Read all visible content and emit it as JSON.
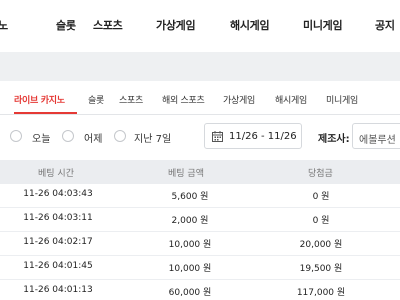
{
  "top_nav": {
    "items": [
      "노",
      "슬롯",
      "스포츠",
      "가상게임",
      "해시게임",
      "미니게임",
      "공지"
    ]
  },
  "sub_tabs": {
    "items": [
      "라이브 카지노",
      "슬롯",
      "스포츠",
      "해외 스포츠",
      "가상게임",
      "해시게임",
      "미니게임"
    ],
    "active_index": 0
  },
  "filters": {
    "radios": [
      "오늘",
      "어제",
      "지난 7일"
    ],
    "date_range": "11/26 - 11/26",
    "provider_label": "제조사:",
    "provider_value": "에볼루션"
  },
  "table": {
    "headers": [
      "베팅 시간",
      "베팅 금액",
      "당첨금"
    ],
    "rows": [
      {
        "time": "11-26 04:03:43",
        "amount": "5,600 원",
        "win": "0 원"
      },
      {
        "time": "11-26 04:03:11",
        "amount": "2,000 원",
        "win": "0 원"
      },
      {
        "time": "11-26 04:02:17",
        "amount": "10,000 원",
        "win": "20,000 원"
      },
      {
        "time": "11-26 04:01:45",
        "amount": "10,000 원",
        "win": "19,500 원"
      },
      {
        "time": "11-26 04:01:13",
        "amount": "60,000 원",
        "win": "117,000 원"
      }
    ]
  },
  "colors": {
    "accent": "#e53935",
    "header_bg": "#ebedf0"
  }
}
